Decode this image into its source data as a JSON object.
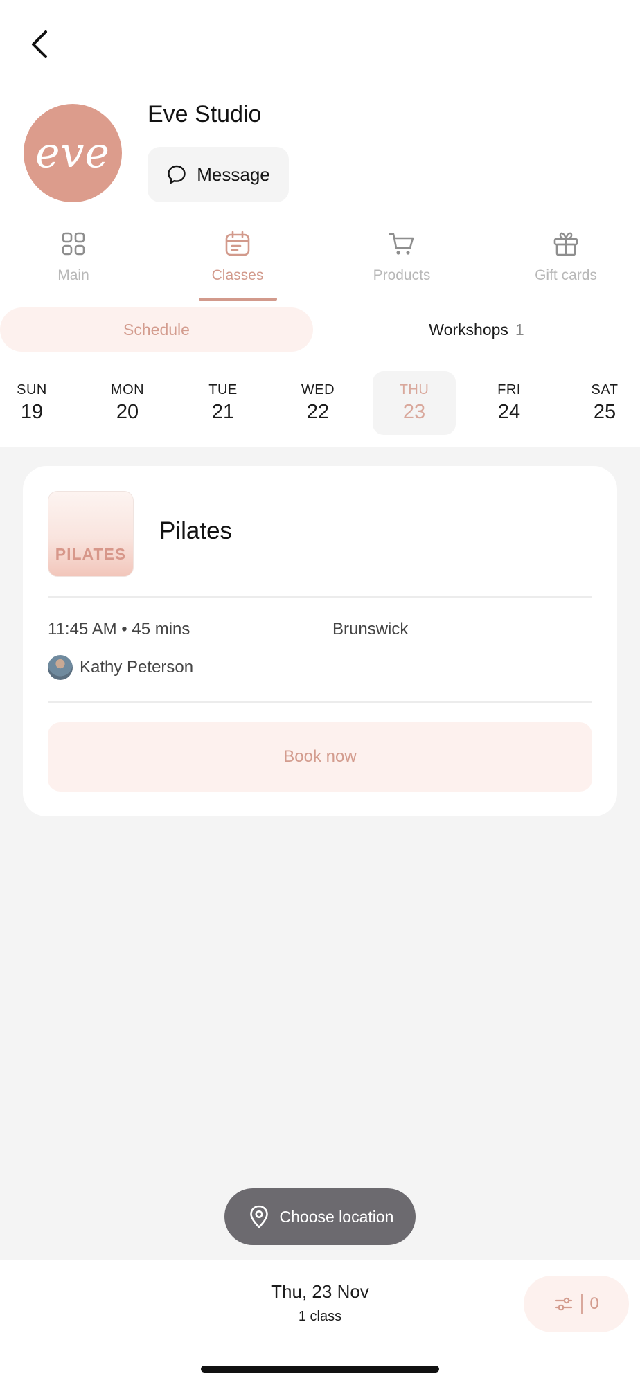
{
  "header": {
    "studio_name": "Eve Studio",
    "logo_text": "eve",
    "message_label": "Message"
  },
  "tabs": [
    {
      "label": "Main",
      "icon": "grid-icon",
      "active": false
    },
    {
      "label": "Classes",
      "icon": "calendar-icon",
      "active": true
    },
    {
      "label": "Products",
      "icon": "cart-icon",
      "active": false
    },
    {
      "label": "Gift cards",
      "icon": "gift-icon",
      "active": false
    }
  ],
  "segments": {
    "schedule_label": "Schedule",
    "workshops_label": "Workshops",
    "workshops_count": "1"
  },
  "days": [
    {
      "name": "SUN",
      "date": "19"
    },
    {
      "name": "MON",
      "date": "20"
    },
    {
      "name": "TUE",
      "date": "21"
    },
    {
      "name": "WED",
      "date": "22"
    },
    {
      "name": "THU",
      "date": "23",
      "selected": true
    },
    {
      "name": "FRI",
      "date": "24"
    },
    {
      "name": "SAT",
      "date": "25"
    }
  ],
  "class_card": {
    "thumb_text": "PILATES",
    "name": "Pilates",
    "time": "11:45 AM • 45 mins",
    "location": "Brunswick",
    "instructor": "Kathy Peterson",
    "book_label": "Book now"
  },
  "choose_location_label": "Choose location",
  "bottom": {
    "selected_date": "Thu, 23 Nov",
    "class_count": "1 class",
    "filter_count": "0"
  },
  "colors": {
    "accent": "#d29a8c",
    "accent_light": "#fdf1ee",
    "logo_bg": "#dc9c8c"
  }
}
